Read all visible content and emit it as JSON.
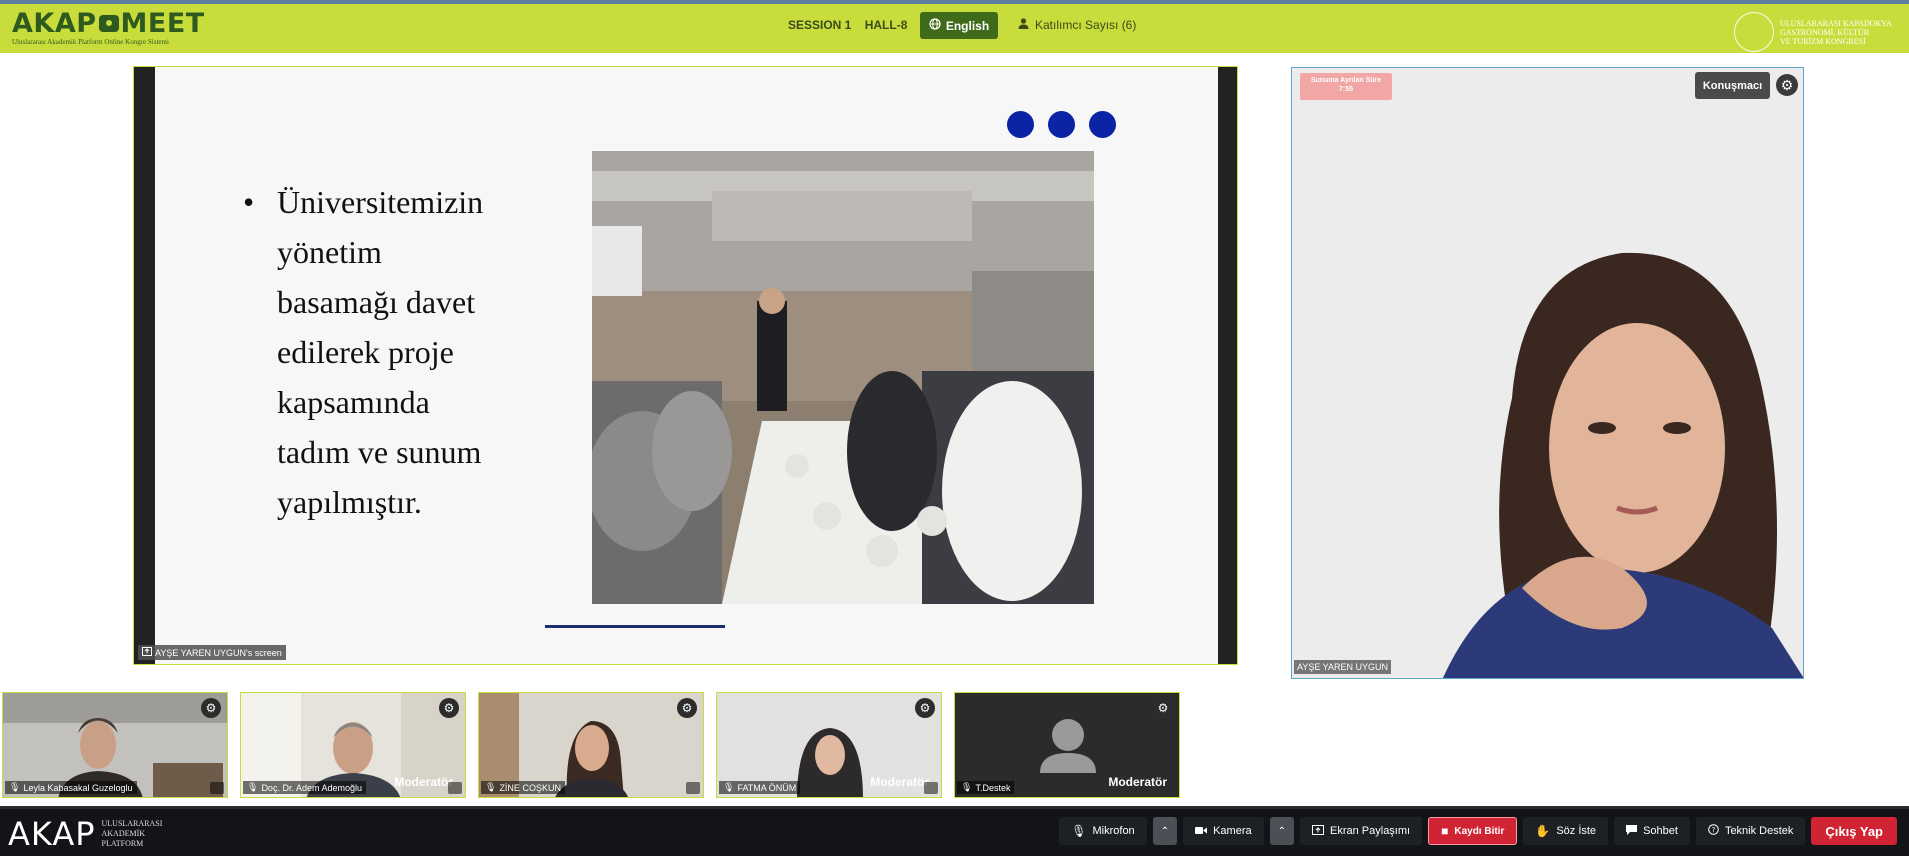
{
  "header": {
    "logo_main_left": "AKAP",
    "logo_main_right": "MEET",
    "logo_sub": "Uluslararası Akademik Platform Online Kongre Sistemi",
    "session": "SESSION 1",
    "hall": "HALL-8",
    "language_button": "English",
    "participants": "Katılımcı Sayısı (6)",
    "event_name_line1": "ULUSLARARASI KAPADOKYA",
    "event_name_line2": "GASTRONOMİ, KÜLTÜR",
    "event_name_line3": "VE TURİZM KONGRESİ"
  },
  "screen_share": {
    "slide_lines": [
      "Üniversitemizin",
      "yönetim",
      "basamağı davet",
      "edilerek proje",
      "kapsamında",
      "tadım ve sunum",
      "yapılmıştır."
    ],
    "label": "AYŞE YAREN UYGUN's screen"
  },
  "speaker": {
    "timer_line1": "Sunuma Ayrılan Süre",
    "timer_line2": "7:55",
    "speaker_button": "Konuşmacı",
    "name": "AYŞE YAREN UYGUN"
  },
  "participants": [
    {
      "name": "Leyla Kabasakal Guzeloglu",
      "role": ""
    },
    {
      "name": "Doç. Dr. Adem Ademoğlu",
      "role": "Moderatör"
    },
    {
      "name": "ZİNE COŞKUN",
      "role": ""
    },
    {
      "name": "FATMA ÖNÜM",
      "role": "Moderatör"
    },
    {
      "name": "T.Destek",
      "role": "Moderatör"
    }
  ],
  "footer": {
    "logo": "AKAP",
    "logo_sub1": "ULUSLARARASI",
    "logo_sub2": "AKADEMİK",
    "logo_sub3": "PLATFORM",
    "mic": "Mikrofon",
    "camera": "Kamera",
    "screen_share": "Ekran Paylaşımı",
    "stop_record": "Kaydı Bitir",
    "raise_hand": "Söz İste",
    "chat": "Sohbet",
    "support": "Teknik Destek",
    "exit": "Çıkış Yap"
  }
}
